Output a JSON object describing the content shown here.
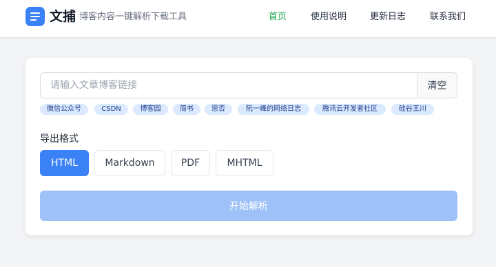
{
  "header": {
    "brand": "文捕",
    "tagline": "博客内容一键解析下载工具",
    "nav": [
      "首页",
      "使用说明",
      "更新日志",
      "联系我们"
    ],
    "active_nav": "首页"
  },
  "form": {
    "url_placeholder": "请输入文章博客链接",
    "url_value": "",
    "clear_label": "清空",
    "sources": [
      "微信公众号",
      "CSDN",
      "博客园",
      "简书",
      "思否",
      "阮一峰的网络日志",
      "腾讯云开发者社区",
      "硅谷王川"
    ],
    "export_label": "导出格式",
    "formats": [
      "HTML",
      "Markdown",
      "PDF",
      "MHTML"
    ],
    "selected_format": "HTML",
    "start_label": "开始解析"
  },
  "colors": {
    "primary": "#3b82f6",
    "nav_active": "#16a34a",
    "tag_bg": "#dbeafe",
    "start_disabled": "#9ec1f8"
  },
  "icons": {
    "logo": "document-lines-icon"
  }
}
